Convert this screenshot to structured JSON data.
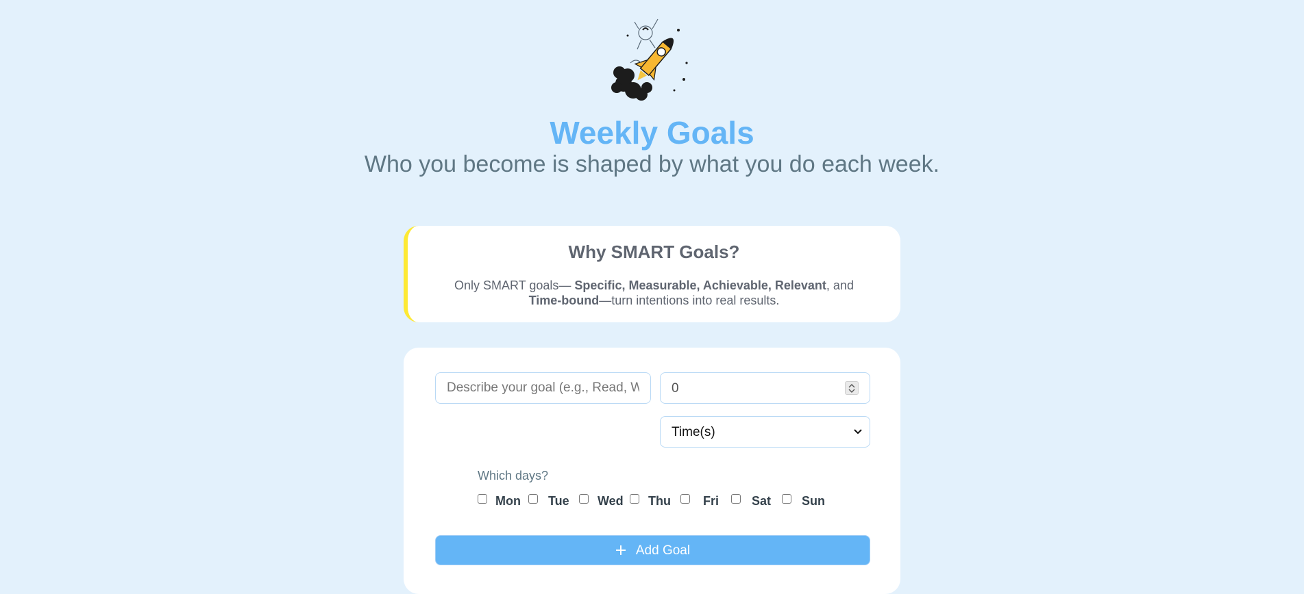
{
  "header": {
    "title": "Weekly Goals",
    "subtitle": "Who you become is shaped by what you do each week."
  },
  "info_card": {
    "title": "Why SMART Goals?",
    "text_prefix": "Only SMART goals— ",
    "text_strong1": "Specific, Measurable, Achievable, Relevant",
    "text_mid": ", and ",
    "text_strong2": "Time-bound",
    "text_suffix": "—turn intentions into real results."
  },
  "form": {
    "goal_placeholder": "Describe your goal (e.g., Read, Walk",
    "count_value": "0",
    "unit_selected": "Time(s)",
    "days_label": "Which days?",
    "days": [
      "Mon",
      "Tue",
      "Wed",
      "Thu",
      "Fri",
      "Sat",
      "Sun"
    ],
    "add_button": "Add Goal"
  },
  "colors": {
    "background": "#e3f1fc",
    "accent": "#64b5f6",
    "card_border_accent": "#fde934"
  },
  "icons": {
    "hero": "rocket-astronaut-illustration",
    "add": "plus-icon",
    "select": "chevron-down-icon",
    "spinner": "spinner-arrows-icon"
  }
}
